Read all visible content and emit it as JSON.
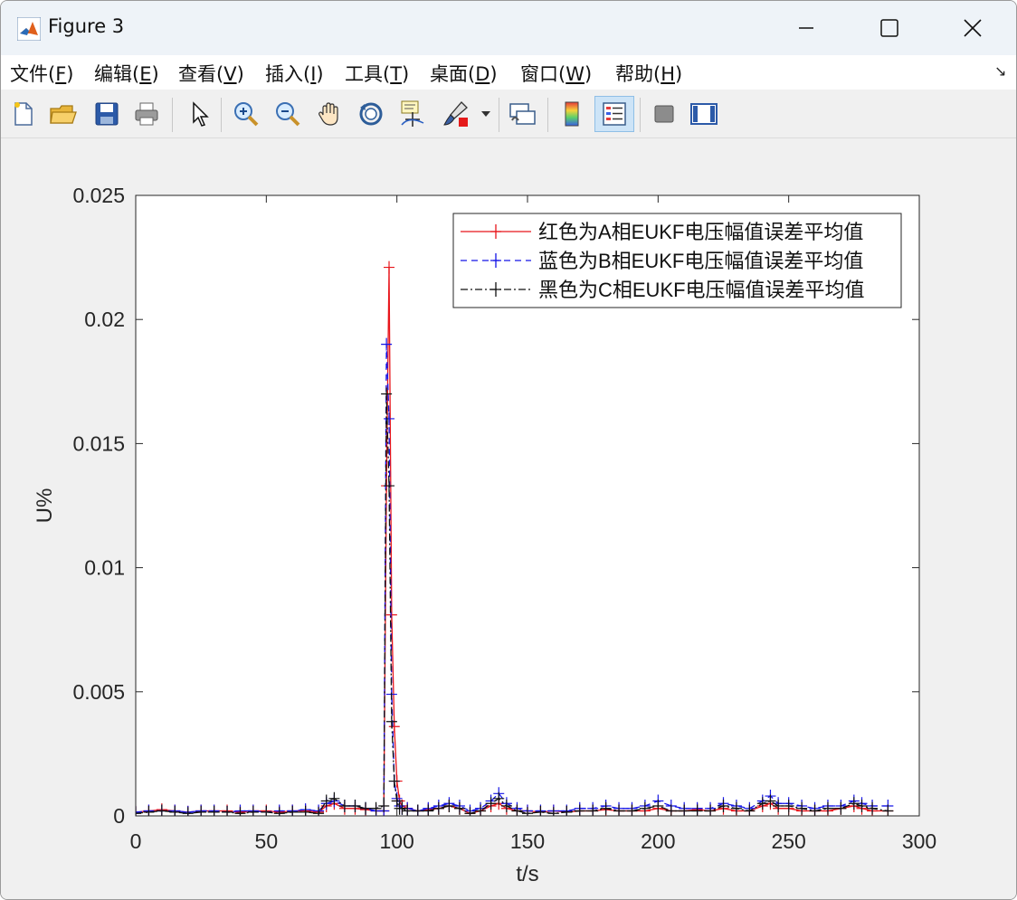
{
  "window": {
    "title": "Figure 3",
    "minimize_glyph": "—",
    "maximize_glyph": "□",
    "close_glyph": "✕"
  },
  "menu": {
    "items": [
      {
        "label": "文件(",
        "key": "F",
        "end": ")"
      },
      {
        "label": "编辑(",
        "key": "E",
        "end": ")"
      },
      {
        "label": "查看(",
        "key": "V",
        "end": ")"
      },
      {
        "label": "插入(",
        "key": "I",
        "end": ")"
      },
      {
        "label": "工具(",
        "key": "T",
        "end": ")"
      },
      {
        "label": "桌面(",
        "key": "D",
        "end": ")"
      },
      {
        "label": "窗口(",
        "key": "W",
        "end": ")"
      },
      {
        "label": "帮助(",
        "key": "H",
        "end": ")"
      }
    ],
    "dock_glyph": "↘"
  },
  "toolbar": {
    "buttons": [
      "new-figure-icon",
      "open-file-icon",
      "save-icon",
      "print-icon",
      "pointer-icon",
      "zoom-in-icon",
      "zoom-out-icon",
      "pan-icon",
      "rotate-3d-icon",
      "data-cursor-icon",
      "brush-icon",
      "brush-dropdown-icon",
      "link-plot-icon",
      "colorbar-icon",
      "legend-icon",
      "hide-plot-tools-icon",
      "show-plot-tools-icon"
    ],
    "active": "legend-icon"
  },
  "chart_data": {
    "type": "line",
    "title": "",
    "xlabel": "t/s",
    "ylabel": "U%",
    "xlim": [
      0,
      300
    ],
    "ylim": [
      0,
      0.025
    ],
    "xticks": [
      0,
      50,
      100,
      150,
      200,
      250,
      300
    ],
    "yticks": [
      0,
      0.005,
      0.01,
      0.015,
      0.02,
      0.025
    ],
    "ytick_labels": [
      "0",
      "0.005",
      "0.01",
      "0.015",
      "0.02",
      "0.025"
    ],
    "grid": false,
    "legend_position": "top-right",
    "series": [
      {
        "name": "红色为A相EUKF电压幅值误差平均值",
        "color": "#e8151b",
        "dash": "",
        "marker": "+",
        "x": [
          0,
          5,
          10,
          15,
          20,
          25,
          30,
          35,
          40,
          45,
          50,
          55,
          60,
          65,
          70,
          73,
          76,
          80,
          84,
          88,
          92,
          95,
          96,
          97,
          98,
          99,
          100,
          101,
          102,
          104,
          108,
          112,
          116,
          120,
          124,
          128,
          132,
          136,
          139,
          142,
          146,
          150,
          155,
          160,
          165,
          170,
          175,
          180,
          185,
          190,
          195,
          200,
          205,
          210,
          215,
          220,
          225,
          230,
          235,
          240,
          243,
          246,
          250,
          255,
          260,
          265,
          270,
          275,
          278,
          282,
          288
        ],
        "y": [
          0.00015,
          0.0002,
          0.00025,
          0.0002,
          0.00015,
          0.0002,
          0.0002,
          0.0002,
          0.00015,
          0.0002,
          0.0002,
          0.00015,
          0.0002,
          0.0002,
          0.00015,
          0.0004,
          0.0005,
          0.0003,
          0.0003,
          0.00025,
          0.0002,
          0.0002,
          0.0133,
          0.0221,
          0.0081,
          0.0036,
          0.0014,
          0.0006,
          0.0004,
          0.0003,
          0.0002,
          0.00025,
          0.0003,
          0.0004,
          0.0003,
          0.0001,
          0.0002,
          0.0004,
          0.0005,
          0.0003,
          0.0002,
          0.0002,
          0.00015,
          0.0002,
          0.00015,
          0.0002,
          0.0002,
          0.00025,
          0.0002,
          0.0002,
          0.0002,
          0.0003,
          0.0002,
          0.0002,
          0.00025,
          0.0002,
          0.0003,
          0.0002,
          0.0002,
          0.0004,
          0.0005,
          0.0003,
          0.0003,
          0.0002,
          0.0002,
          0.0002,
          0.0003,
          0.0004,
          0.0003,
          0.0002,
          0.0002
        ]
      },
      {
        "name": "蓝色为B相EUKF电压幅值误差平均值",
        "color": "#1414e6",
        "dash": "7,5",
        "marker": "+",
        "x": [
          0,
          5,
          10,
          15,
          20,
          25,
          30,
          35,
          40,
          45,
          50,
          55,
          60,
          65,
          70,
          73,
          76,
          80,
          84,
          88,
          92,
          95,
          96,
          97,
          98,
          99,
          100,
          101,
          102,
          104,
          108,
          112,
          116,
          120,
          124,
          128,
          132,
          136,
          139,
          142,
          146,
          150,
          155,
          160,
          165,
          170,
          175,
          180,
          185,
          190,
          195,
          200,
          205,
          210,
          215,
          220,
          225,
          230,
          235,
          240,
          243,
          246,
          250,
          255,
          260,
          265,
          270,
          275,
          278,
          282,
          288
        ],
        "y": [
          0.00015,
          0.0002,
          0.0002,
          0.0002,
          0.00015,
          0.0002,
          0.0002,
          0.00015,
          0.0002,
          0.0002,
          0.00015,
          0.0002,
          0.0002,
          0.00025,
          0.0002,
          0.0005,
          0.0006,
          0.0004,
          0.0004,
          0.0003,
          0.0002,
          0.0002,
          0.019,
          0.016,
          0.0049,
          0.0014,
          0.0007,
          0.0004,
          0.0003,
          0.0003,
          0.0002,
          0.0003,
          0.0004,
          0.0005,
          0.0004,
          0.0002,
          0.0003,
          0.0006,
          0.0009,
          0.0005,
          0.0003,
          0.0002,
          0.0002,
          0.0002,
          0.0002,
          0.0003,
          0.0003,
          0.0004,
          0.0003,
          0.0003,
          0.0004,
          0.0006,
          0.0004,
          0.0003,
          0.0003,
          0.0003,
          0.0005,
          0.0004,
          0.0003,
          0.0006,
          0.0008,
          0.0005,
          0.0005,
          0.0004,
          0.0003,
          0.0004,
          0.0004,
          0.0006,
          0.0005,
          0.0004,
          0.0004
        ]
      },
      {
        "name": "黑色为C相EUKF电压幅值误差平均值",
        "color": "#111111",
        "dash": "8,3,2,3",
        "marker": "+",
        "x": [
          0,
          5,
          10,
          15,
          20,
          25,
          30,
          35,
          40,
          45,
          50,
          55,
          60,
          65,
          70,
          73,
          76,
          80,
          84,
          88,
          92,
          95,
          96,
          97,
          98,
          99,
          100,
          101,
          102,
          104,
          108,
          112,
          116,
          120,
          124,
          128,
          132,
          136,
          139,
          142,
          146,
          150,
          155,
          160,
          165,
          170,
          175,
          180,
          185,
          190,
          195,
          200,
          205,
          210,
          215,
          220,
          225,
          230,
          235,
          240,
          243,
          246,
          250,
          255,
          260,
          265,
          270,
          275,
          278,
          282,
          288
        ],
        "y": [
          0.0001,
          0.00015,
          0.0002,
          0.00015,
          0.0001,
          0.00015,
          0.00015,
          0.00015,
          0.0001,
          0.00015,
          0.00015,
          0.0001,
          0.00015,
          0.00015,
          0.0001,
          0.0006,
          0.0007,
          0.0004,
          0.0004,
          0.0003,
          0.0003,
          0.0004,
          0.017,
          0.0133,
          0.0038,
          0.0014,
          0.0006,
          0.0003,
          0.0003,
          0.0002,
          0.0002,
          0.0002,
          0.0003,
          0.0004,
          0.0003,
          0.0001,
          0.0002,
          0.0005,
          0.0007,
          0.0004,
          0.0002,
          0.0001,
          0.00015,
          0.0001,
          0.00015,
          0.0002,
          0.0002,
          0.0003,
          0.0002,
          0.0002,
          0.0003,
          0.0004,
          0.0002,
          0.0002,
          0.0002,
          0.0002,
          0.0004,
          0.0003,
          0.0002,
          0.0005,
          0.0006,
          0.0004,
          0.0004,
          0.0003,
          0.0002,
          0.0003,
          0.0003,
          0.0005,
          0.0004,
          0.0003,
          0.0002
        ]
      }
    ]
  }
}
